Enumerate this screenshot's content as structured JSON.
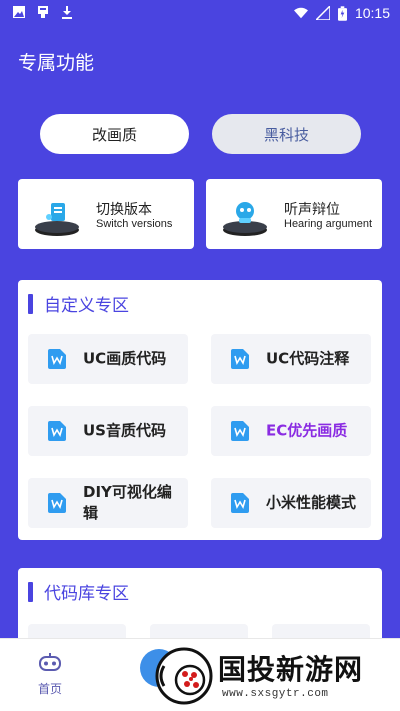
{
  "status_bar": {
    "time": "10:15",
    "left_icons": [
      "image-icon",
      "bug-icon",
      "download-icon"
    ],
    "right_icons": [
      "wifi-icon",
      "signal-icon",
      "battery-icon"
    ]
  },
  "header": {
    "title": "专属功能"
  },
  "tabs": [
    {
      "label": "改画质",
      "active": true
    },
    {
      "label": "黑科技",
      "active": false
    }
  ],
  "features": [
    {
      "title": "切换版本",
      "subtitle": "Switch versions",
      "icon": "document-pedestal-icon"
    },
    {
      "title": "听声辩位",
      "subtitle": "Hearing argument",
      "icon": "robot-pedestal-icon"
    }
  ],
  "custom_section": {
    "title": "自定义专区",
    "items": [
      {
        "label": "UC画质代码",
        "icon": "doc-w-icon"
      },
      {
        "label": "UC代码注释",
        "icon": "doc-w-icon"
      },
      {
        "label": "US音质代码",
        "icon": "doc-w-icon"
      },
      {
        "label": "EC优先画质",
        "icon": "doc-w-icon",
        "color": "#8a2be2"
      },
      {
        "label": "DIY可视化编辑",
        "icon": "doc-w-icon"
      },
      {
        "label": "小米性能模式",
        "icon": "doc-w-icon"
      }
    ]
  },
  "code_section": {
    "title": "代码库专区"
  },
  "bottom_nav": {
    "home_label": "首页"
  },
  "watermark": {
    "title": "国投新游网",
    "url": "www.sxsgytr.com"
  },
  "colors": {
    "accent": "#4a44e0",
    "purple_text": "#8a2be2",
    "item_bg": "#f3f4f8"
  }
}
